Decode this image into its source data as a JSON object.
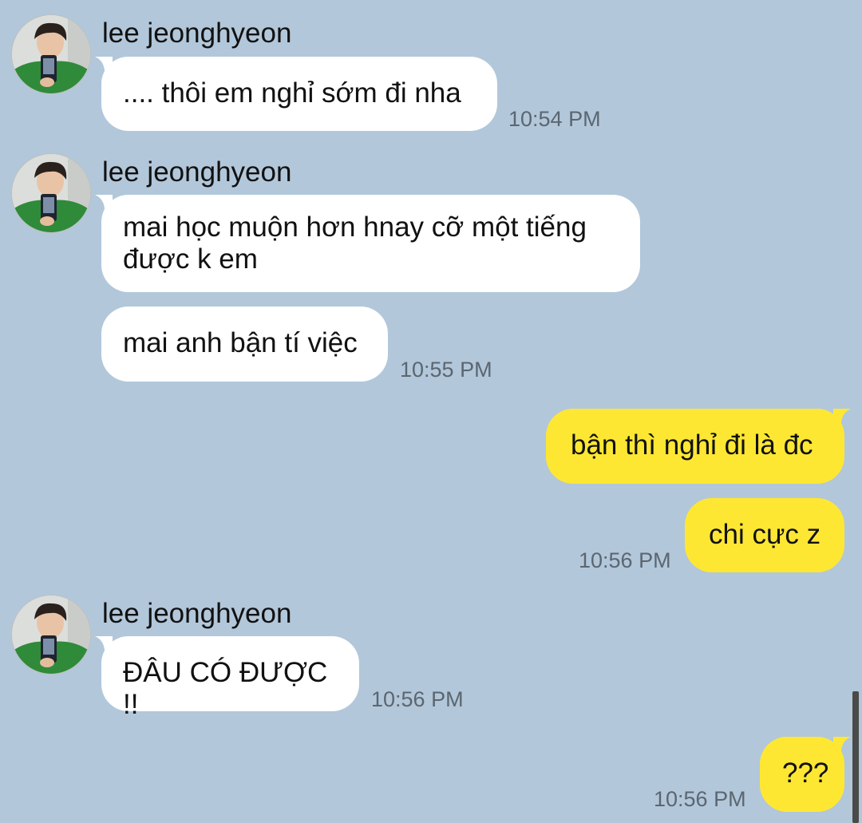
{
  "colors": {
    "background": "#b2c7da",
    "incoming_bubble": "#ffffff",
    "outgoing_bubble": "#fee733",
    "timestamp": "#5b6670",
    "scrollbar": "#4a4a4a"
  },
  "messages": [
    {
      "sender": "lee jeonghyeon",
      "text": ".... thôi em nghỉ sớm đi nha",
      "time": "10:54 PM"
    },
    {
      "sender": "lee jeonghyeon",
      "text": "mai học muộn hơn hnay cỡ một tiếng được k em"
    },
    {
      "text": "mai anh bận tí việc",
      "time": "10:55 PM"
    },
    {
      "text": "bận thì nghỉ đi là đc"
    },
    {
      "text": "chi cực z",
      "time": "10:56 PM"
    },
    {
      "sender": "lee jeonghyeon",
      "text": "ĐÂU CÓ ĐƯỢC !!",
      "time": "10:56 PM"
    },
    {
      "text": "???",
      "time": "10:56 PM"
    }
  ],
  "icons": {
    "avatar": "profile-photo",
    "scrollbar": "scrollbar-thumb"
  }
}
